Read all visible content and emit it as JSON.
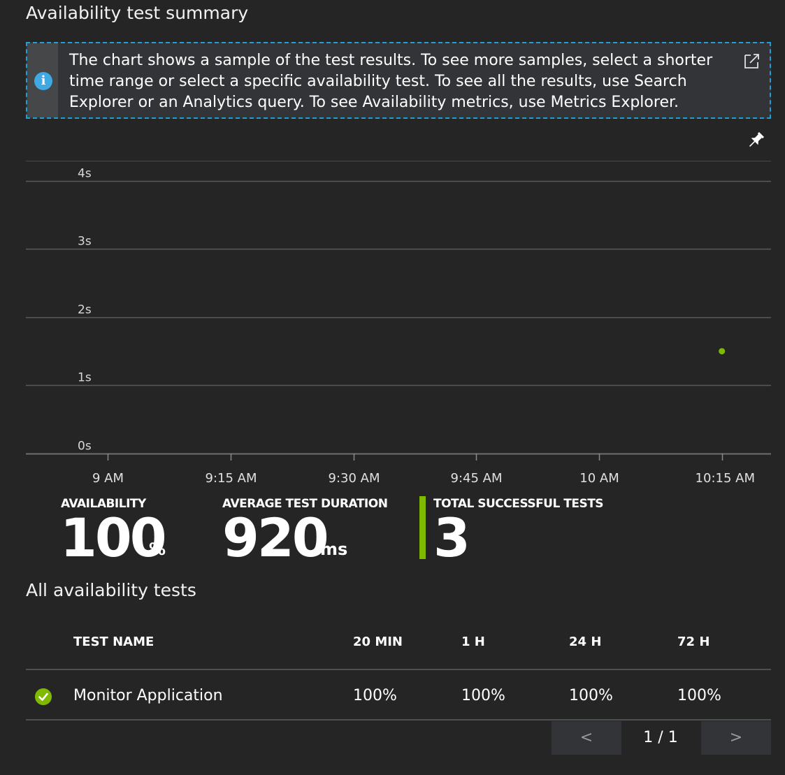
{
  "summary": {
    "title": "Availability test summary",
    "info_text": "The chart shows a sample of the test results. To see more samples, select a shorter time range or select a specific availability test. To see all the results, use Search Explorer or an Analytics query. To see Availability metrics, use Metrics Explorer."
  },
  "icons": {
    "info": "info-icon",
    "external_link": "external-link-icon",
    "pin": "pin-icon",
    "status": "check-circle-icon"
  },
  "colors": {
    "accent_blue": "#1f9ed8",
    "success_green": "#7fba00"
  },
  "chart_data": {
    "type": "scatter",
    "title": "",
    "xlabel": "",
    "ylabel": "",
    "y_ticks": [
      "0s",
      "1s",
      "2s",
      "3s",
      "4s"
    ],
    "ylim": [
      0,
      4.3
    ],
    "x_ticks": [
      "9 AM",
      "9:15 AM",
      "9:30 AM",
      "9:45 AM",
      "10 AM",
      "10:15 AM"
    ],
    "xlim": [
      "8:50 AM",
      "10:21 AM"
    ],
    "grid": true,
    "series": [
      {
        "x": [
          "10:15 AM"
        ],
        "y": [
          1.5
        ],
        "color": "#7fba00"
      }
    ]
  },
  "kpis": {
    "availability": {
      "label": "AVAILABILITY",
      "value": "100",
      "unit": "%"
    },
    "avg_duration": {
      "label": "AVERAGE TEST DURATION",
      "value": "920",
      "unit": "ms"
    },
    "successful": {
      "label": "TOTAL SUCCESSFUL TESTS",
      "value": "3"
    }
  },
  "tests": {
    "title": "All availability tests",
    "columns": [
      "TEST NAME",
      "20 MIN",
      "1 H",
      "24 H",
      "72 H"
    ],
    "rows": [
      {
        "name": "Monitor Application",
        "status": "success",
        "values": [
          "100%",
          "100%",
          "100%",
          "100%"
        ]
      }
    ]
  },
  "pager": {
    "prev": "<",
    "next": ">",
    "label": "1 / 1"
  }
}
